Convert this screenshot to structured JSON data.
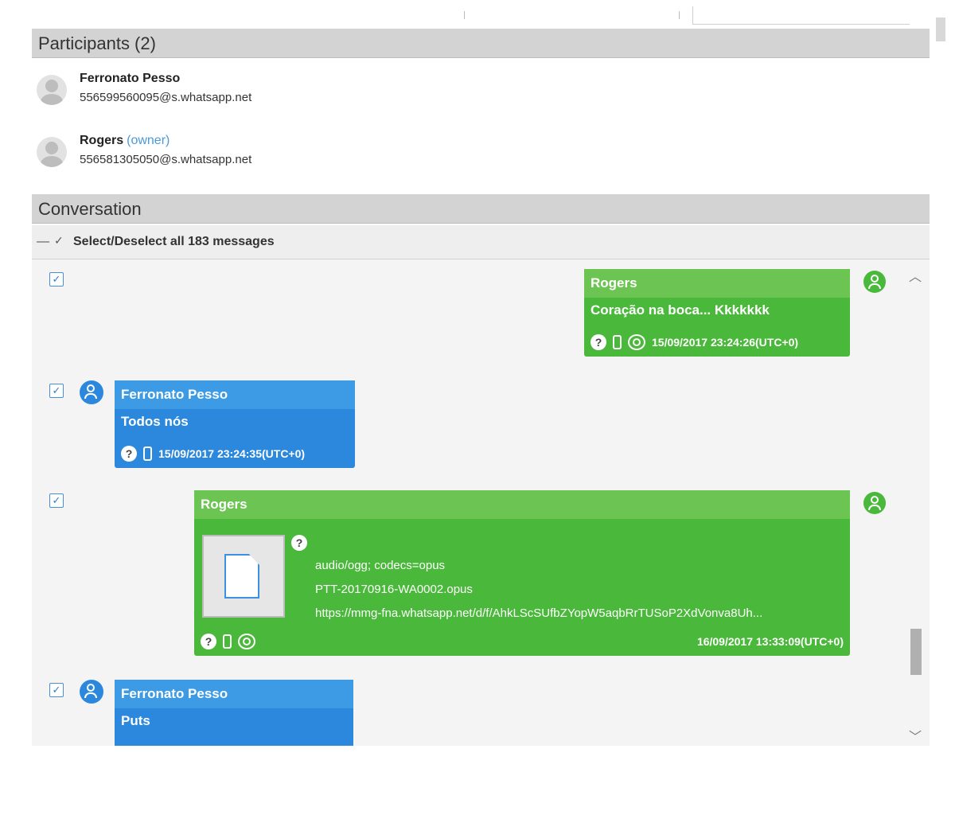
{
  "participants": {
    "title": "Participants (2)",
    "items": [
      {
        "name": "Ferronato Pesso",
        "owner_tag": "",
        "jid": "556599560095@s.whatsapp.net"
      },
      {
        "name": "Rogers",
        "owner_tag": "(owner)",
        "jid": "556581305050@s.whatsapp.net"
      }
    ]
  },
  "conversation": {
    "title": "Conversation",
    "select_all_label": "Select/Deselect all 183 messages",
    "messages": [
      {
        "sender": "Rogers",
        "text": "Coração na boca... Kkkkkkk",
        "timestamp": "15/09/2017 23:24:26(UTC+0)"
      },
      {
        "sender": "Ferronato Pesso",
        "text": "Todos nós",
        "timestamp": "15/09/2017 23:24:35(UTC+0)"
      },
      {
        "sender": "Rogers",
        "mime": "audio/ogg; codecs=opus",
        "filename": "PTT-20170916-WA0002.opus",
        "url": "https://mmg-fna.whatsapp.net/d/f/AhkLScSUfbZYopW5aqbRrTUSoP2XdVonva8Uh...",
        "timestamp": "16/09/2017 13:33:09(UTC+0)"
      },
      {
        "sender": "Ferronato Pesso",
        "text": "Puts"
      }
    ]
  },
  "colors": {
    "green": "#4ab83a",
    "blue": "#2b88dc",
    "header_gray": "#d3d3d3"
  }
}
